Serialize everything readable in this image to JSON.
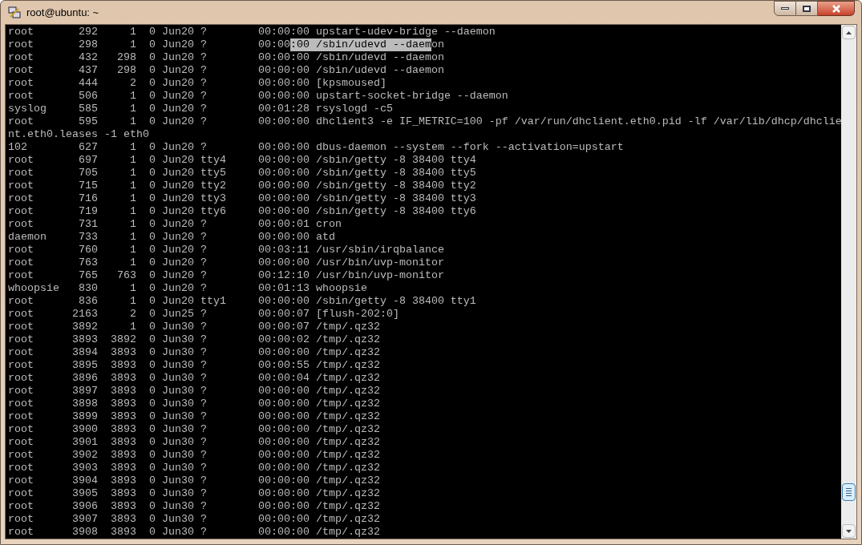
{
  "window": {
    "title": "root@ubuntu: ~"
  },
  "terminal": {
    "lines": [
      [
        {
          "text": "root       292     1  0 Jun20 ?        00:00:00 upstart-udev-bridge --daemon",
          "selected": false
        }
      ],
      [
        {
          "text": "root       298     1  0 Jun20 ?        00:00",
          "selected": false
        },
        {
          "text": ":00 /sbin/udevd --daem",
          "selected": true
        },
        {
          "text": "on",
          "selected": false
        }
      ],
      [
        {
          "text": "root       432   298  0 Jun20 ?        00:00:00 /sbin/udevd --daemon",
          "selected": false
        }
      ],
      [
        {
          "text": "root       437   298  0 Jun20 ?        00:00:00 /sbin/udevd --daemon",
          "selected": false
        }
      ],
      [
        {
          "text": "root       444     2  0 Jun20 ?        00:00:00 [kpsmoused]",
          "selected": false
        }
      ],
      [
        {
          "text": "root       506     1  0 Jun20 ?        00:00:00 upstart-socket-bridge --daemon",
          "selected": false
        }
      ],
      [
        {
          "text": "syslog     585     1  0 Jun20 ?        00:01:28 rsyslogd -c5",
          "selected": false
        }
      ],
      [
        {
          "text": "root       595     1  0 Jun20 ?        00:00:00 dhclient3 -e IF_METRIC=100 -pf /var/run/dhclient.eth0.pid -lf /var/lib/dhcp/dhclie",
          "selected": false
        }
      ],
      [
        {
          "text": "nt.eth0.leases -1 eth0",
          "selected": false
        }
      ],
      [
        {
          "text": "102        627     1  0 Jun20 ?        00:00:00 dbus-daemon --system --fork --activation=upstart",
          "selected": false
        }
      ],
      [
        {
          "text": "root       697     1  0 Jun20 tty4     00:00:00 /sbin/getty -8 38400 tty4",
          "selected": false
        }
      ],
      [
        {
          "text": "root       705     1  0 Jun20 tty5     00:00:00 /sbin/getty -8 38400 tty5",
          "selected": false
        }
      ],
      [
        {
          "text": "root       715     1  0 Jun20 tty2     00:00:00 /sbin/getty -8 38400 tty2",
          "selected": false
        }
      ],
      [
        {
          "text": "root       716     1  0 Jun20 tty3     00:00:00 /sbin/getty -8 38400 tty3",
          "selected": false
        }
      ],
      [
        {
          "text": "root       719     1  0 Jun20 tty6     00:00:00 /sbin/getty -8 38400 tty6",
          "selected": false
        }
      ],
      [
        {
          "text": "root       731     1  0 Jun20 ?        00:00:01 cron",
          "selected": false
        }
      ],
      [
        {
          "text": "daemon     733     1  0 Jun20 ?        00:00:00 atd",
          "selected": false
        }
      ],
      [
        {
          "text": "root       760     1  0 Jun20 ?        00:03:11 /usr/sbin/irqbalance",
          "selected": false
        }
      ],
      [
        {
          "text": "root       763     1  0 Jun20 ?        00:00:00 /usr/bin/uvp-monitor",
          "selected": false
        }
      ],
      [
        {
          "text": "root       765   763  0 Jun20 ?        00:12:10 /usr/bin/uvp-monitor",
          "selected": false
        }
      ],
      [
        {
          "text": "whoopsie   830     1  0 Jun20 ?        00:01:13 whoopsie",
          "selected": false
        }
      ],
      [
        {
          "text": "root       836     1  0 Jun20 tty1     00:00:00 /sbin/getty -8 38400 tty1",
          "selected": false
        }
      ],
      [
        {
          "text": "root      2163     2  0 Jun25 ?        00:00:07 [flush-202:0]",
          "selected": false
        }
      ],
      [
        {
          "text": "root      3892     1  0 Jun30 ?        00:00:07 /tmp/.qz32",
          "selected": false
        }
      ],
      [
        {
          "text": "root      3893  3892  0 Jun30 ?        00:00:02 /tmp/.qz32",
          "selected": false
        }
      ],
      [
        {
          "text": "root      3894  3893  0 Jun30 ?        00:00:00 /tmp/.qz32",
          "selected": false
        }
      ],
      [
        {
          "text": "root      3895  3893  0 Jun30 ?        00:00:55 /tmp/.qz32",
          "selected": false
        }
      ],
      [
        {
          "text": "root      3896  3893  0 Jun30 ?        00:00:04 /tmp/.qz32",
          "selected": false
        }
      ],
      [
        {
          "text": "root      3897  3893  0 Jun30 ?        00:00:00 /tmp/.qz32",
          "selected": false
        }
      ],
      [
        {
          "text": "root      3898  3893  0 Jun30 ?        00:00:00 /tmp/.qz32",
          "selected": false
        }
      ],
      [
        {
          "text": "root      3899  3893  0 Jun30 ?        00:00:00 /tmp/.qz32",
          "selected": false
        }
      ],
      [
        {
          "text": "root      3900  3893  0 Jun30 ?        00:00:00 /tmp/.qz32",
          "selected": false
        }
      ],
      [
        {
          "text": "root      3901  3893  0 Jun30 ?        00:00:00 /tmp/.qz32",
          "selected": false
        }
      ],
      [
        {
          "text": "root      3902  3893  0 Jun30 ?        00:00:00 /tmp/.qz32",
          "selected": false
        }
      ],
      [
        {
          "text": "root      3903  3893  0 Jun30 ?        00:00:00 /tmp/.qz32",
          "selected": false
        }
      ],
      [
        {
          "text": "root      3904  3893  0 Jun30 ?        00:00:00 /tmp/.qz32",
          "selected": false
        }
      ],
      [
        {
          "text": "root      3905  3893  0 Jun30 ?        00:00:00 /tmp/.qz32",
          "selected": false
        }
      ],
      [
        {
          "text": "root      3906  3893  0 Jun30 ?        00:00:00 /tmp/.qz32",
          "selected": false
        }
      ],
      [
        {
          "text": "root      3907  3893  0 Jun30 ?        00:00:00 /tmp/.qz32",
          "selected": false
        }
      ],
      [
        {
          "text": "root      3908  3893  0 Jun30 ?        00:00:00 /tmp/.qz32",
          "selected": false
        }
      ]
    ]
  }
}
